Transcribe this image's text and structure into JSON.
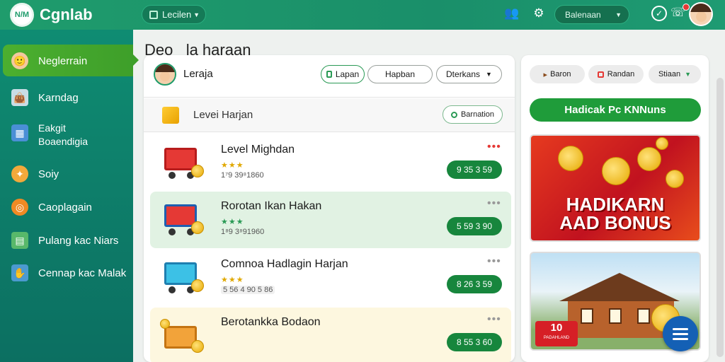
{
  "app": {
    "logo_text": "Cgnlab",
    "logo_badge": "N/M"
  },
  "topbar": {
    "select_label": "Lecilen",
    "dropdown_label": "Balenaan"
  },
  "sidebar": {
    "items": [
      {
        "label": "Neglerrain"
      },
      {
        "label": "Karndag"
      },
      {
        "label": "Eakgit\nBoaendigia"
      },
      {
        "label": "Soiy"
      },
      {
        "label": "Caoplagain"
      },
      {
        "label": "Pulang kac Niars"
      },
      {
        "label": "Cennap kac Malak"
      }
    ]
  },
  "page": {
    "title": "Deo   la haraan"
  },
  "panel": {
    "user_name": "Leraja",
    "pills": [
      "Lapan",
      "Hapban",
      "Dterkans"
    ],
    "filter_label": "Levei Harjan",
    "filter_button": "Barnation",
    "rows": [
      {
        "title": "Level Mighdan",
        "stars": "★★★",
        "sub": "1⁷9 39⁸1860",
        "price": "9 35 3 59",
        "menu": "•••"
      },
      {
        "title": "Rorotan Ikan Hakan",
        "stars": "★★★",
        "sub": "1⁸9 3⁸91960",
        "price": "5 59 3 90",
        "menu": "•••"
      },
      {
        "title": "Comnoa Hadlagin Harjan",
        "stars": "★★★",
        "sub": "5 56 4 90 5 86",
        "price": "8 26 3 59",
        "menu": "•••"
      },
      {
        "title": "Berotankka Bodaon",
        "stars": "",
        "sub": "",
        "price": "8 55 3 60",
        "menu": "•••"
      }
    ]
  },
  "right": {
    "chips": [
      "Baron",
      "Randan",
      "Stiaan"
    ],
    "banner": "Hadicak Pc KNNuns",
    "promo_title": "HADIKARN\nAAD BONUS",
    "house_badge": "10",
    "house_badge_sub": "PADAHLAND"
  },
  "colors": {
    "primary": "#1f9c6c",
    "active": "#3e9f2a",
    "price": "#17863d",
    "fab": "#1460b5"
  }
}
